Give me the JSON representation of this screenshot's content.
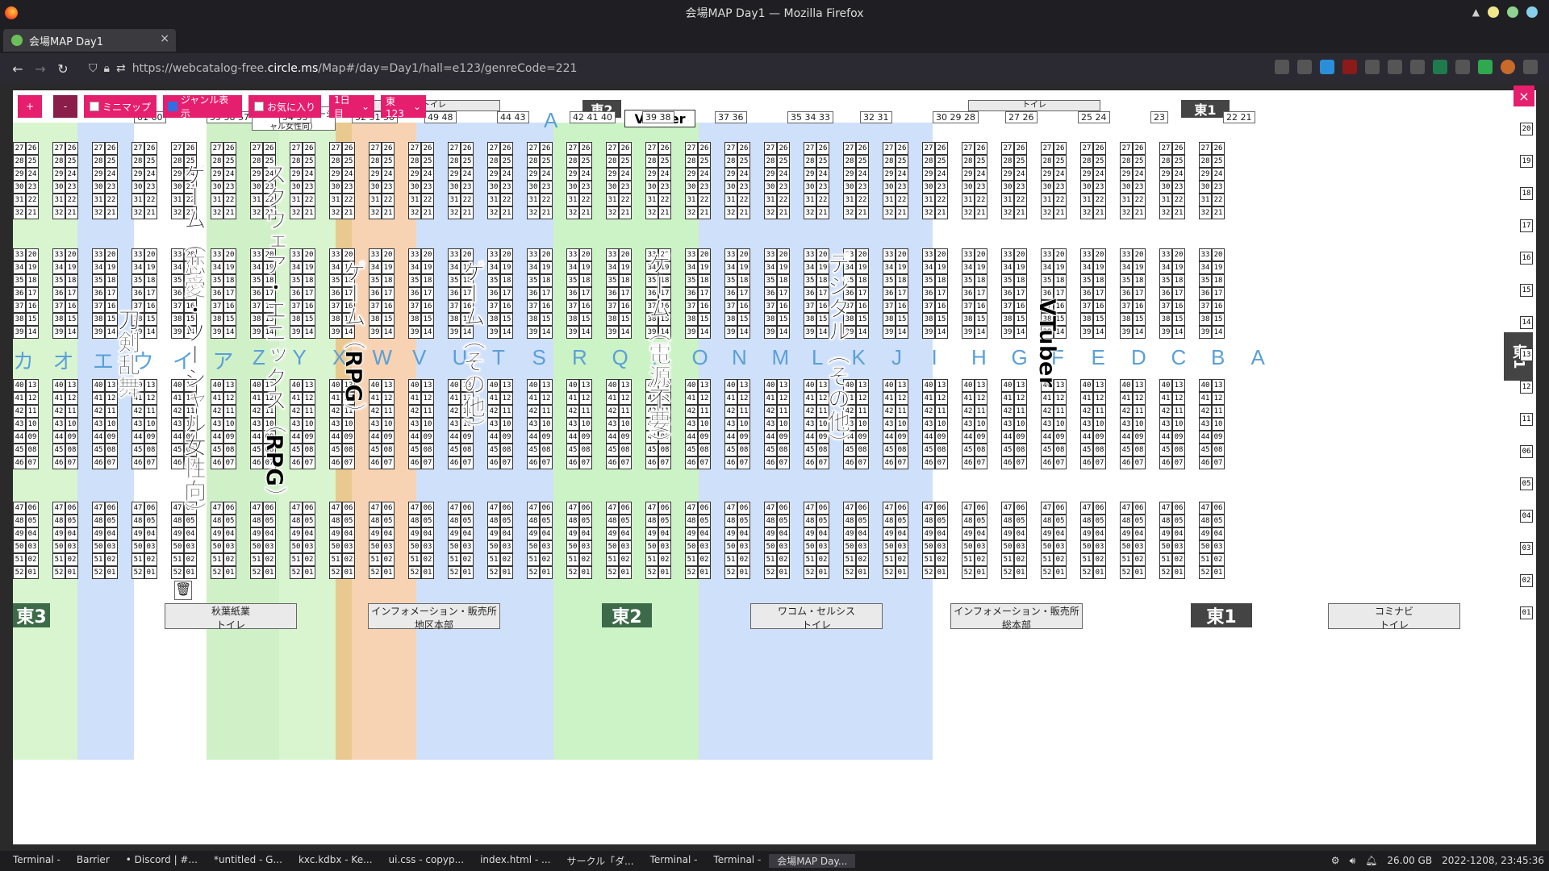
{
  "window": {
    "title": "会場MAP Day1 — Mozilla Firefox"
  },
  "tab": {
    "label": "会場MAP Day1",
    "close": "×",
    "new_tab": "+"
  },
  "nav": {
    "back": "←",
    "forward": "→",
    "reload": "↻",
    "url_prefix": "https://webcatalog-free.",
    "url_domain": "circle.ms",
    "url_suffix": "/Map#/day=Day1/hall=e123/genreCode=221"
  },
  "toolbar": {
    "zoom_in": "+",
    "zoom_out": "-",
    "minimap": "ミニマップ",
    "genre": "ジャンル表示",
    "favorite": "お気に入り",
    "day": "1日目",
    "hall": "東123",
    "close": "×"
  },
  "toolbar_state": {
    "minimap": false,
    "genre": true,
    "favorite": false
  },
  "row_labels": [
    "カ",
    "オ",
    "エ",
    "ウ",
    "イ",
    "ア",
    "Z",
    "Y",
    "X",
    "W",
    "V",
    "U",
    "T",
    "S",
    "R",
    "Q",
    "P",
    "O",
    "N",
    "M",
    "L",
    "K",
    "J",
    "I",
    "H",
    "G",
    "F",
    "E",
    "D",
    "C",
    "B",
    "A"
  ],
  "genre_labels": [
    {
      "text": "刀剣乱舞",
      "color": "#e9c98f"
    },
    {
      "text": "ゲーム（恋愛・ソーシャル女性向）",
      "color": "#d9f5d0"
    },
    {
      "text": "スクウェア・エニックス（RPG）",
      "color": "#d0f0c8"
    },
    {
      "text": "ゲーム（RPG）",
      "color": "#f7d3b4"
    },
    {
      "text": "ゲーム（その他）",
      "color": "#cfe0fb"
    },
    {
      "text": "ゲーム（電源不要）",
      "color": "#ccf3c5"
    },
    {
      "text": "デジタル（その他）",
      "color": "#cfe0fb"
    },
    {
      "text": "VTuber",
      "color": "#ffffff"
    }
  ],
  "halls": {
    "e3": "東3",
    "e2": "東2",
    "e1": "東1",
    "e2_top": "東2",
    "e1_top": "東1",
    "e1_side": "東1",
    "vtuber_top": "VTuber"
  },
  "facilities": [
    {
      "top": "秋葉紙業",
      "bottom": "トイレ"
    },
    {
      "top": "インフォメーション・販売所",
      "bottom": "地区本部"
    },
    {
      "top": "ワコム・セルシス",
      "bottom": "トイレ"
    },
    {
      "top": "インフォメーション・販売所",
      "bottom": "総本部"
    },
    {
      "top": "コミナビ",
      "bottom": "トイレ"
    }
  ],
  "top_notes": {
    "game_women": "ゲーム（恋愛・ソーシャル女性向）",
    "toilet1": "トイレ",
    "toilet2": "トイレ",
    "row_a": "A"
  },
  "blocks_top": [
    "61 60",
    "59 58 57",
    "54 53",
    "52 51 50",
    "49 48",
    "44 43",
    "42 41 40",
    "39 38",
    "37 36",
    "35 34 33",
    "32 31",
    "30 29 28",
    "27 26",
    "25 24",
    "23",
    "22 21"
  ],
  "side_numbers": [
    "20",
    "19",
    "18",
    "17",
    "16",
    "15",
    "14",
    "13",
    "12",
    "11",
    "06",
    "05",
    "04",
    "03",
    "02",
    "01"
  ],
  "cell_pairs": {
    "r1": [
      "27 26",
      "28 25",
      "29 24",
      "30 23",
      "31 22",
      "32 21"
    ],
    "r2": [
      "33 20",
      "34 19",
      "35 18",
      "36 17",
      "37 16",
      "38 15",
      "39 14"
    ],
    "r3": [
      "40 13",
      "41 12",
      "42 11",
      "43 10",
      "44 09",
      "45 08",
      "46 07"
    ],
    "r4": [
      "47 06",
      "48 05",
      "49 04",
      "50 03",
      "51 02",
      "52 01"
    ]
  },
  "taskbar": {
    "items": [
      "Terminal -",
      "Barrier",
      "• Discord | #...",
      "*untitled - G...",
      "kxc.kdbx - Ke...",
      "ui.css - copyp...",
      "index.html - ...",
      "サークル「ダ...",
      "Terminal -",
      "Terminal -",
      "会場MAP Day..."
    ],
    "disk": "26.00 GB",
    "clock": "2022-1208, 23:45:36"
  },
  "colors": {
    "accent": "#e61e6e",
    "accent_dark": "#8a1d4a",
    "hall_badge": "#3d6b4a",
    "row_label": "#5aa0d8"
  }
}
